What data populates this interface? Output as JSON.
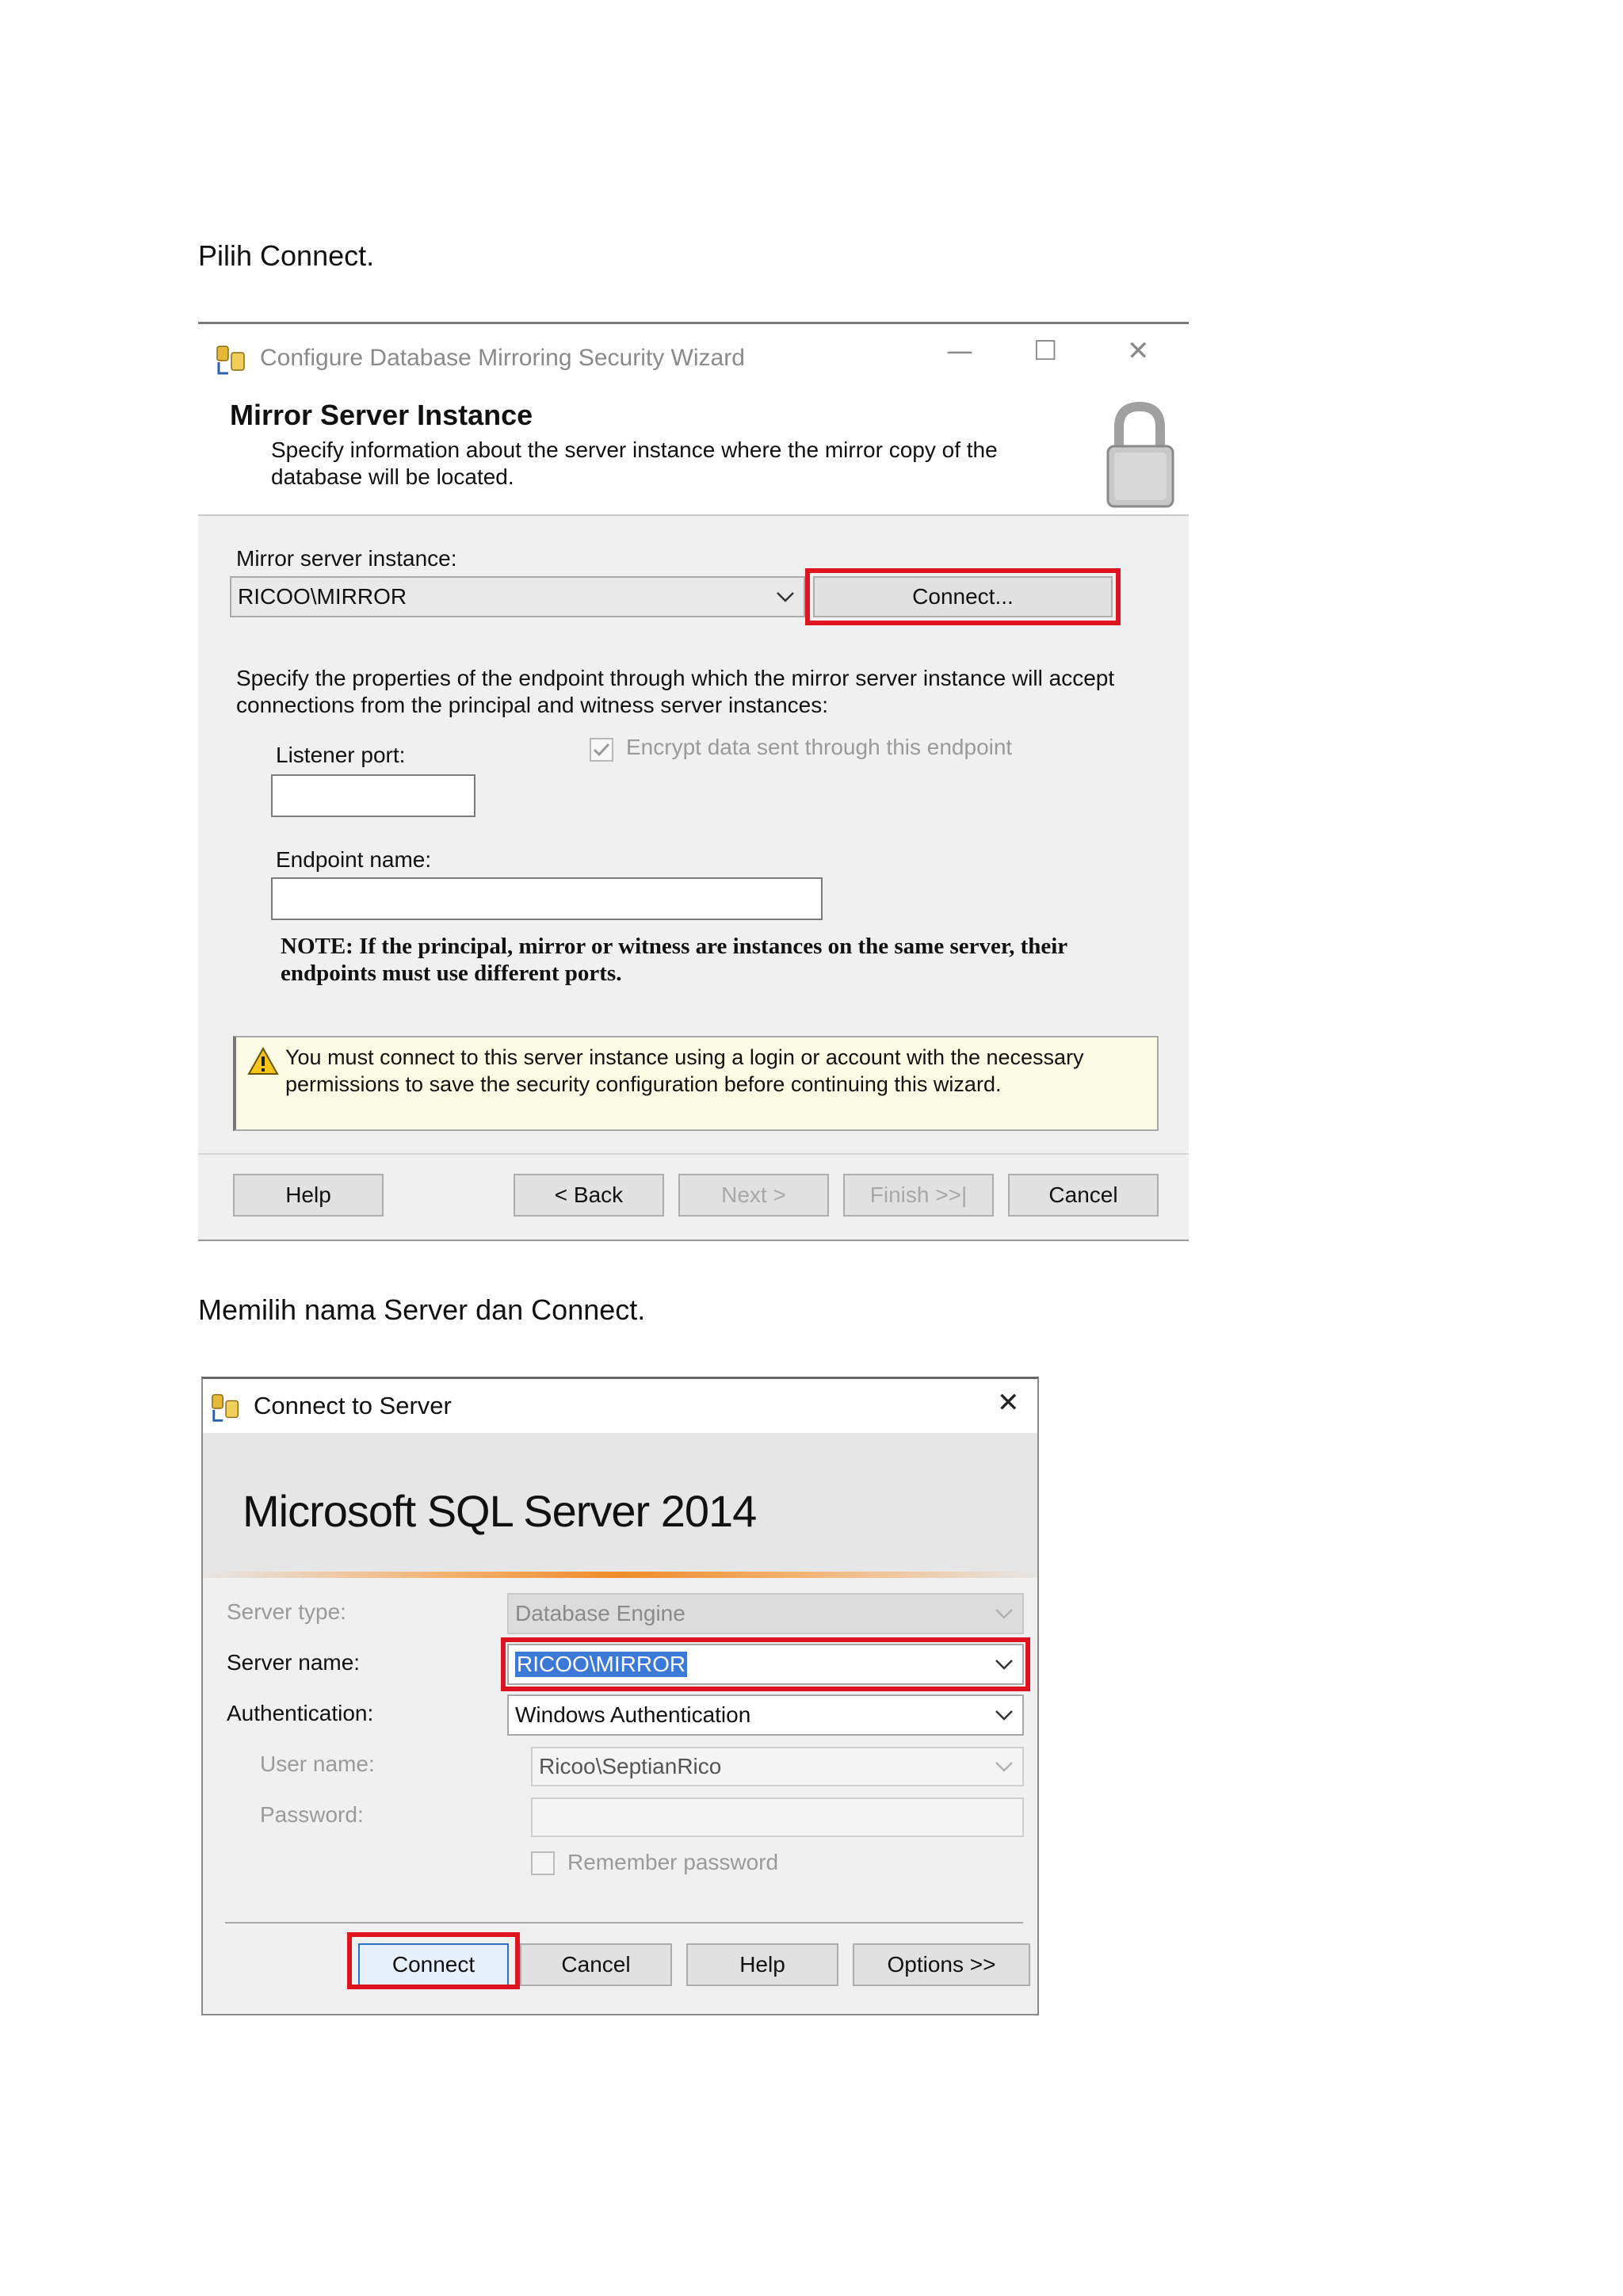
{
  "captions": {
    "first": "Pilih Connect.",
    "second": "Memilih nama Server dan Connect."
  },
  "wizard": {
    "window_title": "Configure Database Mirroring Security Wizard",
    "header_title": "Mirror Server Instance",
    "header_desc": "Specify information about the server instance where the mirror copy of the database will be located.",
    "mirror_label": "Mirror server instance:",
    "mirror_value": "RICOO\\MIRROR",
    "connect_label": "Connect...",
    "endpoint_desc": "Specify the properties of the endpoint through which the mirror server instance will accept connections from the principal and witness server instances:",
    "listener_label": "Listener port:",
    "listener_value": "",
    "encrypt_label": "Encrypt data sent through this endpoint",
    "encrypt_checked": true,
    "endpoint_label": "Endpoint name:",
    "endpoint_value": "",
    "note": "NOTE: If the principal, mirror or witness are instances on the same server, their endpoints must use different ports.",
    "warning": "You must connect to this server instance using a login or account with the necessary permissions to save the security configuration before continuing this wizard.",
    "buttons": {
      "help": "Help",
      "back": "< Back",
      "next": "Next >",
      "finish": "Finish >>|",
      "cancel": "Cancel"
    },
    "highlight_color": "#e0141e"
  },
  "connect_dialog": {
    "window_title": "Connect to Server",
    "product": "Microsoft SQL Server 2014",
    "server_type_label": "Server type:",
    "server_type_value": "Database Engine",
    "server_name_label": "Server name:",
    "server_name_value": "RICOO\\MIRROR",
    "auth_label": "Authentication:",
    "auth_value": "Windows Authentication",
    "user_label": "User name:",
    "user_value": "Ricoo\\SeptianRico",
    "password_label": "Password:",
    "password_value": "",
    "remember_label": "Remember password",
    "remember_checked": false,
    "buttons": {
      "connect": "Connect",
      "cancel": "Cancel",
      "help": "Help",
      "options": "Options >>"
    },
    "selection_color": "#3b78d8",
    "highlight_color": "#e0141e"
  }
}
